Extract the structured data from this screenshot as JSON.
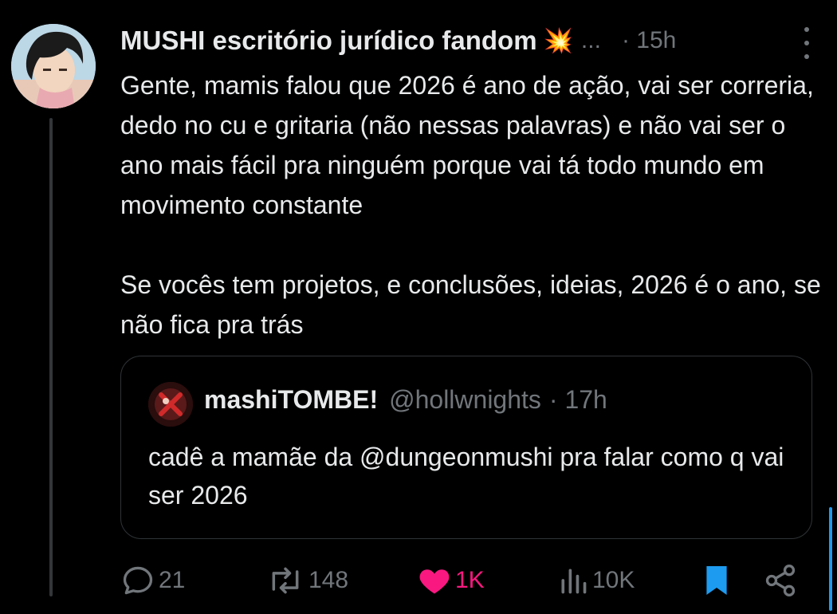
{
  "post": {
    "display_name": "MUSHI escritório jurídico fandom",
    "name_emoji": "💥",
    "name_ellipsis": "...",
    "time": "· 15h",
    "text_paragraph_1": "Gente, mamis falou que 2026 é ano de ação, vai ser correria, dedo no cu e gritaria (não nessas palavras) e não vai ser o ano mais fácil pra ninguém porque vai tá todo mundo em movimento constante",
    "text_paragraph_2": "Se vocês tem projetos, e conclusões, ideias, 2026 é o ano, se não fica pra trás"
  },
  "quote": {
    "name": "mashiTOMBE!",
    "handle": "@hollwnights",
    "time": "· 17h",
    "text": "cadê a mamãe da @dungeonmushi pra falar como q vai ser 2026"
  },
  "actions": {
    "replies": "21",
    "reposts": "148",
    "likes": "1K",
    "views": "10K"
  },
  "icons": {
    "reply": "reply-icon",
    "repost": "repost-icon",
    "like": "heart-icon",
    "views": "views-icon",
    "bookmark": "bookmark-icon",
    "share": "share-icon",
    "more": "more-icon"
  },
  "colors": {
    "background": "#000000",
    "text": "#e7e9ea",
    "muted": "#71767b",
    "like": "#f91880",
    "bookmark": "#1d9bf0"
  }
}
